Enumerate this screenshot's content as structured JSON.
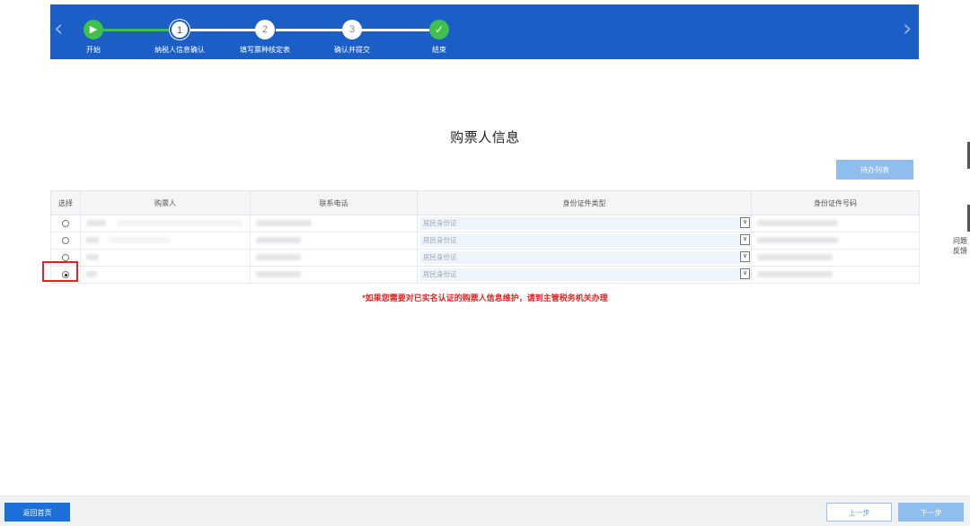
{
  "steps": [
    {
      "label": "开始",
      "mark": "▶",
      "state": "done"
    },
    {
      "label": "纳税人信息确认",
      "mark": "1",
      "state": "current"
    },
    {
      "label": "填写票种核定表",
      "mark": "2",
      "state": "pending"
    },
    {
      "label": "确认并提交",
      "mark": "3",
      "state": "pending"
    },
    {
      "label": "结束",
      "mark": "✓",
      "state": "finish"
    }
  ],
  "nav": {
    "prev_icon": "chevron-left-icon",
    "next_icon": "chevron-right-icon"
  },
  "page_title": "购票人信息",
  "toolbar": {
    "todo_label": "待办列表"
  },
  "table": {
    "columns": [
      "选择",
      "购票人",
      "联系电话",
      "身份证件类型",
      "身份证件号码"
    ],
    "rows": [
      {
        "selected": false,
        "id_type": "居民身份证"
      },
      {
        "selected": false,
        "id_type": "居民身份证"
      },
      {
        "selected": false,
        "id_type": "居民身份证"
      },
      {
        "selected": true,
        "id_type": "居民身份证"
      }
    ]
  },
  "warning_note": "*如果您需要对已实名认证的购票人信息维护，请到主管税务机关办理",
  "side": {
    "feedback_label": "问题反馈"
  },
  "footer": {
    "home_label": "返回首页",
    "prev_label": "上一步",
    "next_label": "下一步"
  },
  "colors": {
    "brand_blue": "#1b5fc6",
    "step_green": "#3fc14b",
    "warning_red": "#e02424"
  }
}
